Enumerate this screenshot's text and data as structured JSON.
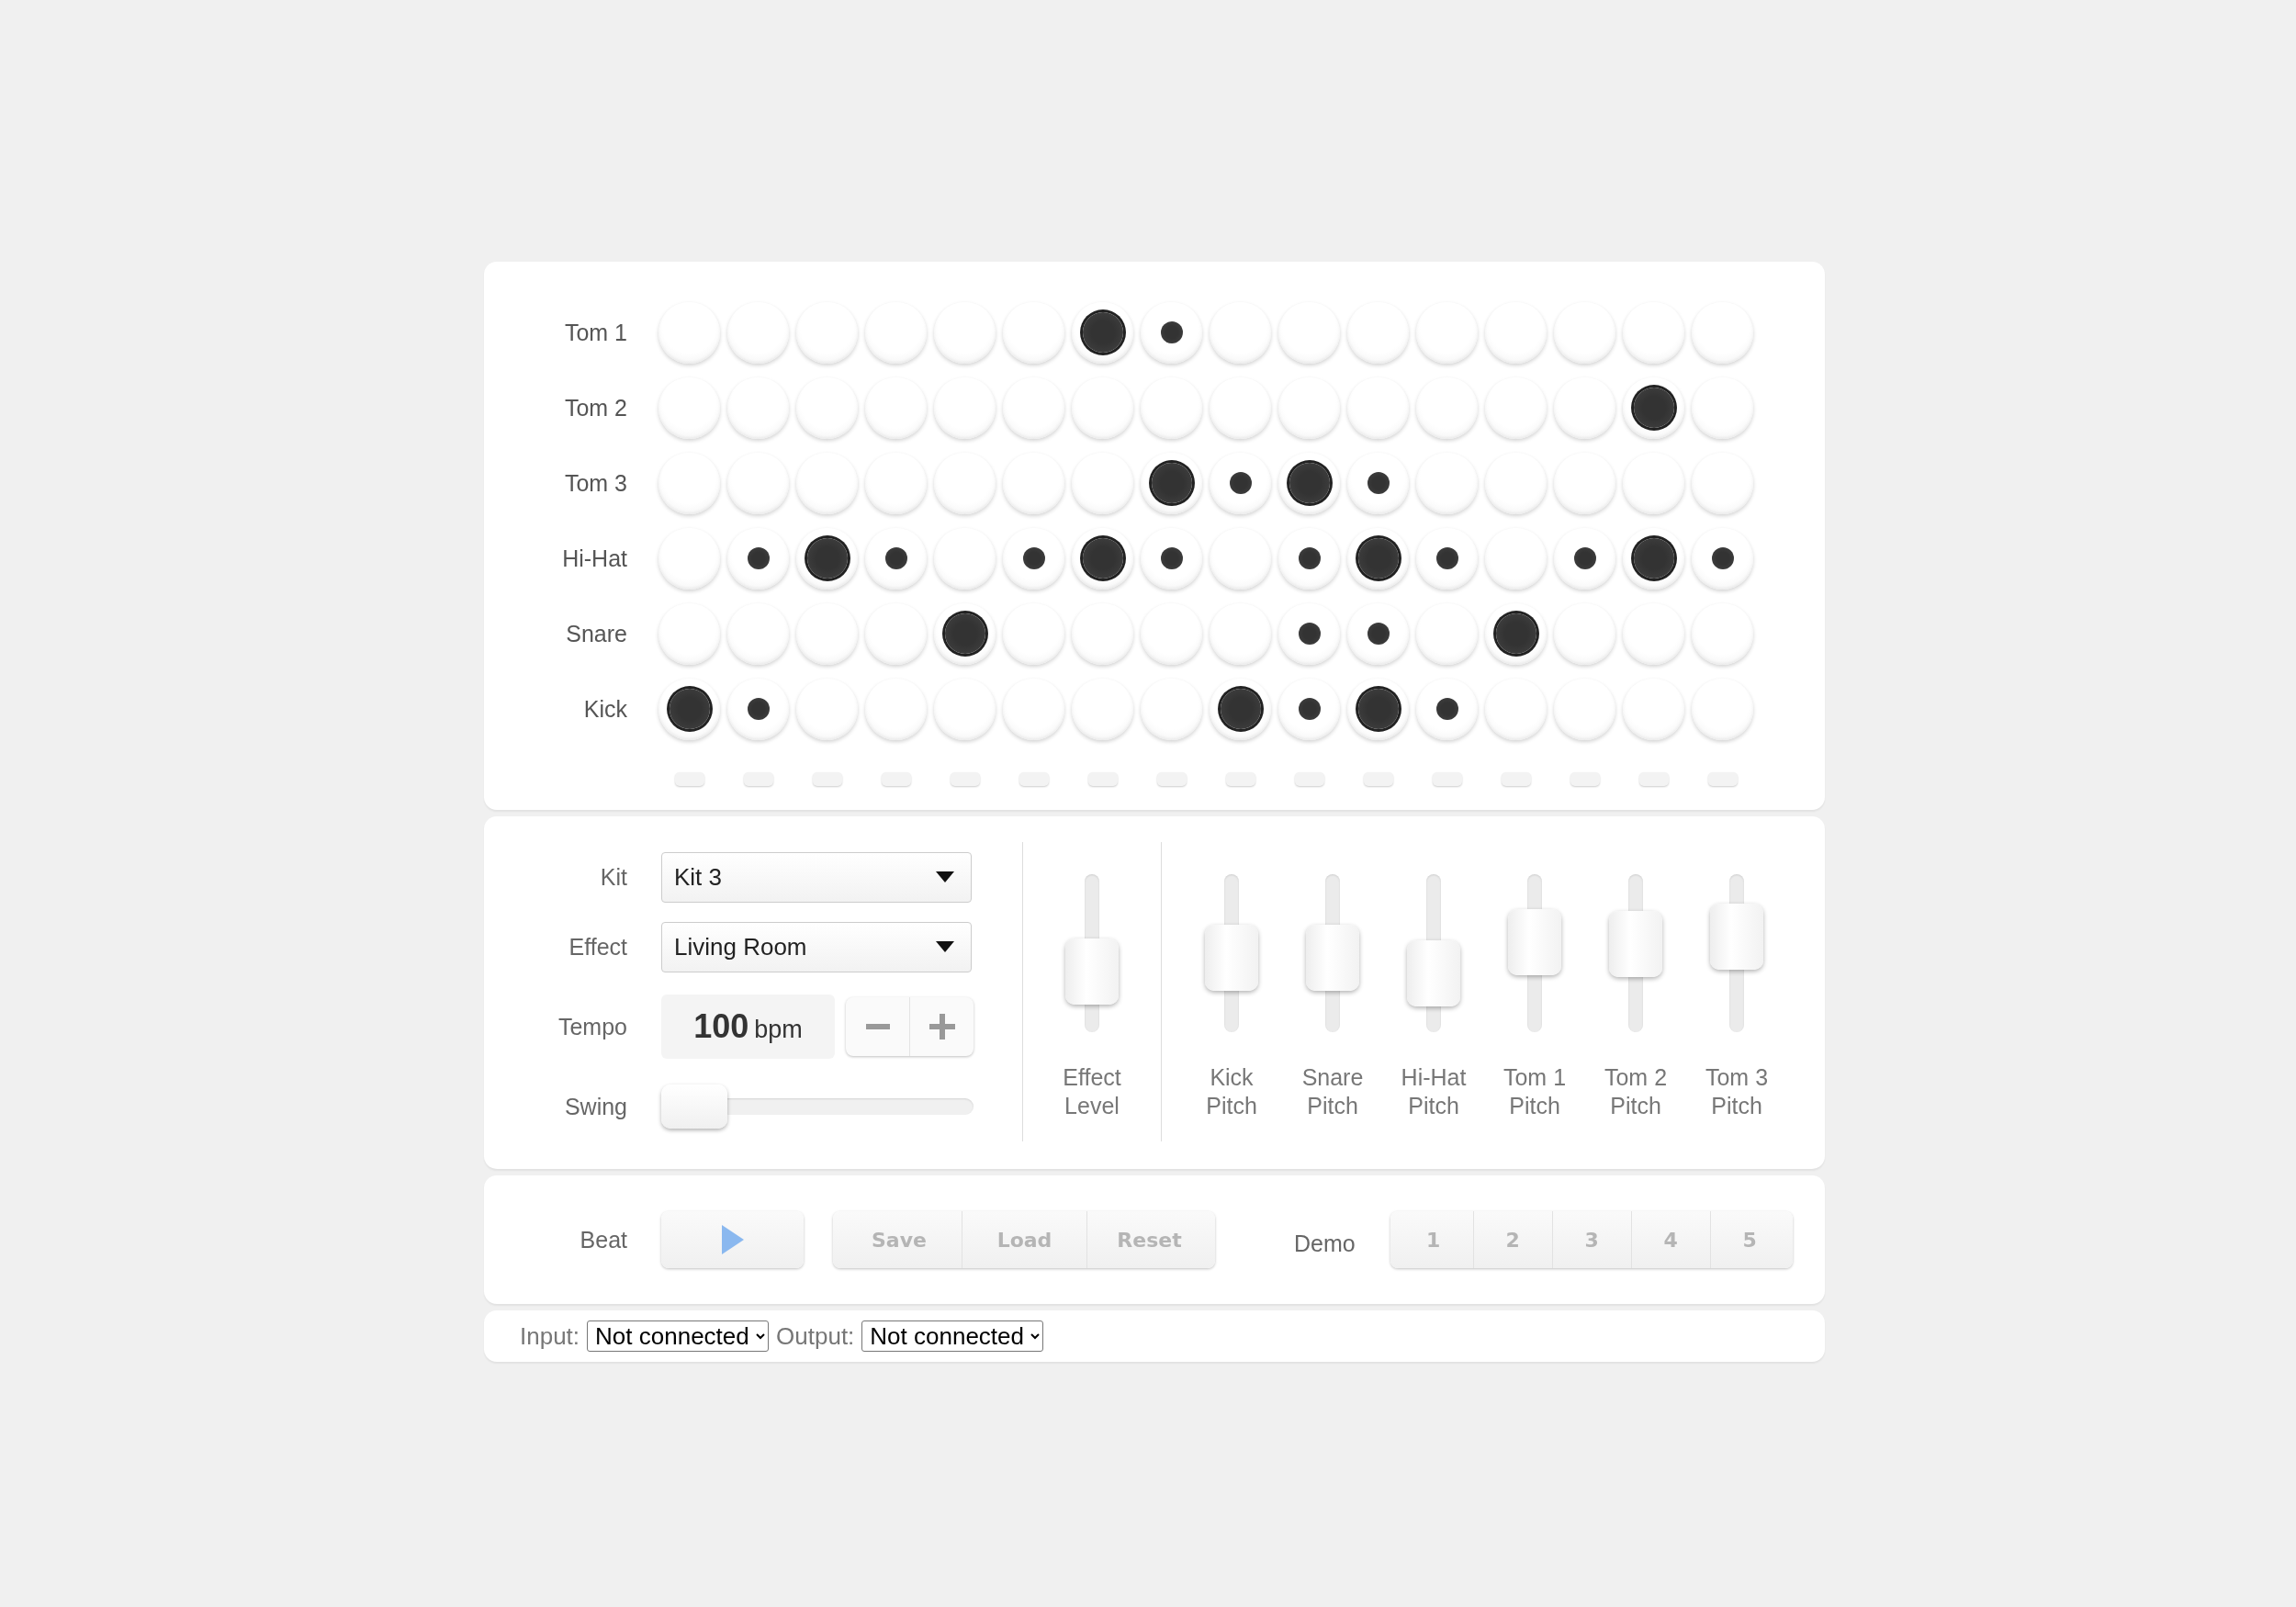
{
  "grid": {
    "rows": [
      {
        "label": "Tom 1",
        "steps": [
          {
            "on": false,
            "accent": false
          },
          {
            "on": false,
            "accent": false
          },
          {
            "on": false,
            "accent": false
          },
          {
            "on": false,
            "accent": false
          },
          {
            "on": false,
            "accent": false
          },
          {
            "on": false,
            "accent": false
          },
          {
            "on": true,
            "accent": true
          },
          {
            "on": true,
            "accent": false
          },
          {
            "on": false,
            "accent": false
          },
          {
            "on": false,
            "accent": false
          },
          {
            "on": false,
            "accent": false
          },
          {
            "on": false,
            "accent": false
          },
          {
            "on": false,
            "accent": false
          },
          {
            "on": false,
            "accent": false
          },
          {
            "on": false,
            "accent": false
          },
          {
            "on": false,
            "accent": false
          }
        ]
      },
      {
        "label": "Tom 2",
        "steps": [
          {
            "on": false,
            "accent": false
          },
          {
            "on": false,
            "accent": false
          },
          {
            "on": false,
            "accent": false
          },
          {
            "on": false,
            "accent": false
          },
          {
            "on": false,
            "accent": false
          },
          {
            "on": false,
            "accent": false
          },
          {
            "on": false,
            "accent": false
          },
          {
            "on": false,
            "accent": false
          },
          {
            "on": false,
            "accent": false
          },
          {
            "on": false,
            "accent": false
          },
          {
            "on": false,
            "accent": false
          },
          {
            "on": false,
            "accent": false
          },
          {
            "on": false,
            "accent": false
          },
          {
            "on": false,
            "accent": false
          },
          {
            "on": true,
            "accent": true
          },
          {
            "on": false,
            "accent": false
          }
        ]
      },
      {
        "label": "Tom 3",
        "steps": [
          {
            "on": false,
            "accent": false
          },
          {
            "on": false,
            "accent": false
          },
          {
            "on": false,
            "accent": false
          },
          {
            "on": false,
            "accent": false
          },
          {
            "on": false,
            "accent": false
          },
          {
            "on": false,
            "accent": false
          },
          {
            "on": false,
            "accent": false
          },
          {
            "on": true,
            "accent": true
          },
          {
            "on": true,
            "accent": false
          },
          {
            "on": true,
            "accent": true
          },
          {
            "on": true,
            "accent": false
          },
          {
            "on": false,
            "accent": false
          },
          {
            "on": false,
            "accent": false
          },
          {
            "on": false,
            "accent": false
          },
          {
            "on": false,
            "accent": false
          },
          {
            "on": false,
            "accent": false
          }
        ]
      },
      {
        "label": "Hi-Hat",
        "steps": [
          {
            "on": false,
            "accent": false
          },
          {
            "on": true,
            "accent": false
          },
          {
            "on": true,
            "accent": true
          },
          {
            "on": true,
            "accent": false
          },
          {
            "on": false,
            "accent": false
          },
          {
            "on": true,
            "accent": false
          },
          {
            "on": true,
            "accent": true
          },
          {
            "on": true,
            "accent": false
          },
          {
            "on": false,
            "accent": false
          },
          {
            "on": true,
            "accent": false
          },
          {
            "on": true,
            "accent": true
          },
          {
            "on": true,
            "accent": false
          },
          {
            "on": false,
            "accent": false
          },
          {
            "on": true,
            "accent": false
          },
          {
            "on": true,
            "accent": true
          },
          {
            "on": true,
            "accent": false
          }
        ]
      },
      {
        "label": "Snare",
        "steps": [
          {
            "on": false,
            "accent": false
          },
          {
            "on": false,
            "accent": false
          },
          {
            "on": false,
            "accent": false
          },
          {
            "on": false,
            "accent": false
          },
          {
            "on": true,
            "accent": true
          },
          {
            "on": false,
            "accent": false
          },
          {
            "on": false,
            "accent": false
          },
          {
            "on": false,
            "accent": false
          },
          {
            "on": false,
            "accent": false
          },
          {
            "on": true,
            "accent": false
          },
          {
            "on": true,
            "accent": false
          },
          {
            "on": false,
            "accent": false
          },
          {
            "on": true,
            "accent": true
          },
          {
            "on": false,
            "accent": false
          },
          {
            "on": false,
            "accent": false
          },
          {
            "on": false,
            "accent": false
          }
        ]
      },
      {
        "label": "Kick",
        "steps": [
          {
            "on": true,
            "accent": true
          },
          {
            "on": true,
            "accent": false
          },
          {
            "on": false,
            "accent": false
          },
          {
            "on": false,
            "accent": false
          },
          {
            "on": false,
            "accent": false
          },
          {
            "on": false,
            "accent": false
          },
          {
            "on": false,
            "accent": false
          },
          {
            "on": false,
            "accent": false
          },
          {
            "on": true,
            "accent": true
          },
          {
            "on": true,
            "accent": false
          },
          {
            "on": true,
            "accent": true
          },
          {
            "on": true,
            "accent": false
          },
          {
            "on": false,
            "accent": false
          },
          {
            "on": false,
            "accent": false
          },
          {
            "on": false,
            "accent": false
          },
          {
            "on": false,
            "accent": false
          }
        ]
      }
    ]
  },
  "controls": {
    "kit": {
      "label": "Kit",
      "value": "Kit 3"
    },
    "effect": {
      "label": "Effect",
      "value": "Living Room"
    },
    "tempo": {
      "label": "Tempo",
      "value": "100",
      "unit": "bpm"
    },
    "swing": {
      "label": "Swing",
      "level": 0
    },
    "effect_fader": {
      "label": "Effect Level",
      "level": 0.3
    },
    "pitch_faders": [
      {
        "label": "Kick Pitch",
        "level": 0.45
      },
      {
        "label": "Snare Pitch",
        "level": 0.45
      },
      {
        "label": "Hi-Hat Pitch",
        "level": 0.28
      },
      {
        "label": "Tom 1 Pitch",
        "level": 0.62
      },
      {
        "label": "Tom 2 Pitch",
        "level": 0.6
      },
      {
        "label": "Tom 3 Pitch",
        "level": 0.68
      }
    ]
  },
  "transport": {
    "beat_label": "Beat",
    "actions": [
      "Save",
      "Load",
      "Reset"
    ],
    "demo_label": "Demo",
    "demos": [
      "1",
      "2",
      "3",
      "4",
      "5"
    ]
  },
  "midi": {
    "input_label": "Input:",
    "input_value": "Not connected",
    "output_label": "Output:",
    "output_value": "Not connected"
  }
}
